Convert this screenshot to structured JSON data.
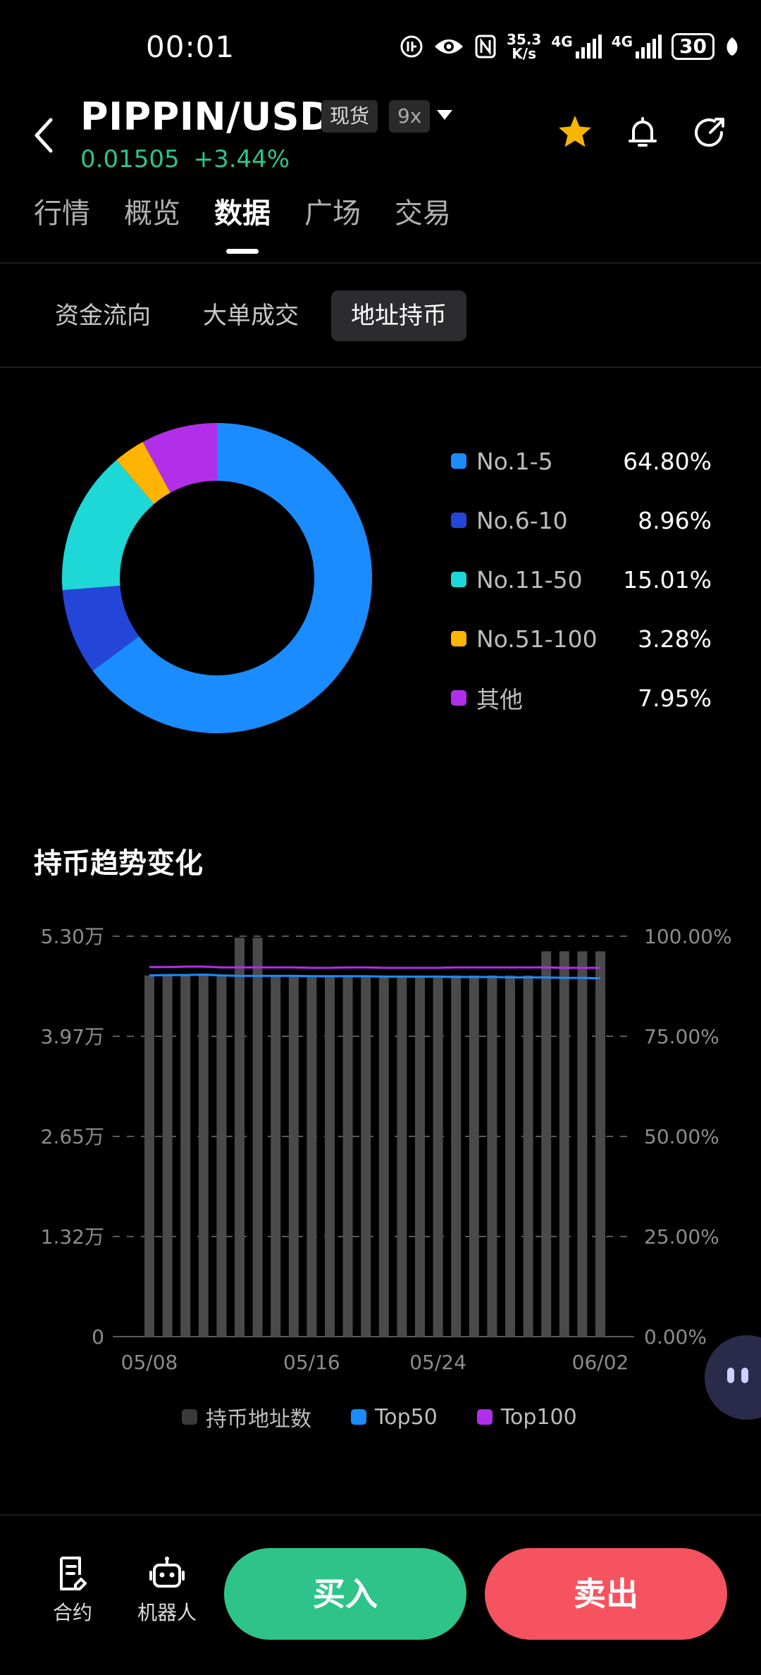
{
  "status_bar": {
    "time": "00:01",
    "net_speed": "35.3",
    "net_unit": "K/s",
    "net1": "4G",
    "net2": "4G",
    "battery": "30"
  },
  "header": {
    "pair": "PIPPIN/USDT",
    "market_tag": "现货",
    "leverage_tag": "9x",
    "price": "0.01505",
    "change": "+3.44%",
    "price_color": "#2ec489"
  },
  "tabs": [
    {
      "label": "行情",
      "active": false
    },
    {
      "label": "概览",
      "active": false
    },
    {
      "label": "数据",
      "active": true
    },
    {
      "label": "广场",
      "active": false
    },
    {
      "label": "交易",
      "active": false
    }
  ],
  "subtabs": [
    {
      "label": "资金流向",
      "active": false
    },
    {
      "label": "大单成交",
      "active": false
    },
    {
      "label": "地址持币",
      "active": true
    }
  ],
  "holdings": {
    "items": [
      {
        "label": "No.1-5",
        "value": "64.80%",
        "pct": 64.8,
        "color": "#1a8cff"
      },
      {
        "label": "No.6-10",
        "value": "8.96%",
        "pct": 8.96,
        "color": "#2446d8"
      },
      {
        "label": "No.11-50",
        "value": "15.01%",
        "pct": 15.01,
        "color": "#1ed8d8"
      },
      {
        "label": "No.51-100",
        "value": "3.28%",
        "pct": 3.28,
        "color": "#ffb400"
      },
      {
        "label": "其他",
        "value": "7.95%",
        "pct": 7.95,
        "color": "#b12fe8"
      }
    ]
  },
  "trend": {
    "title": "持币趋势变化",
    "left_ticks": [
      "0",
      "1.32万",
      "2.65万",
      "3.97万",
      "5.30万"
    ],
    "right_ticks": [
      "0.00%",
      "25.00%",
      "50.00%",
      "75.00%",
      "100.00%"
    ],
    "x_labels": [
      "05/08",
      "05/16",
      "05/24",
      "06/02"
    ],
    "legend": [
      {
        "label": "持币地址数",
        "color": "#3a3a3a"
      },
      {
        "label": "Top50",
        "color": "#1a8cff"
      },
      {
        "label": "Top100",
        "color": "#b12fe8"
      }
    ]
  },
  "chart_data": {
    "type": "bar",
    "title": "持币趋势变化",
    "ylim": [
      0,
      53000
    ],
    "y2lim": [
      0,
      100
    ],
    "x_tick_labels": [
      "05/08",
      "05/16",
      "05/24",
      "06/02"
    ],
    "series": [
      {
        "name": "持币地址数",
        "type": "bar",
        "values": [
          47800,
          47800,
          47800,
          47800,
          47800,
          52800,
          52800,
          47800,
          47800,
          47800,
          47800,
          47800,
          47800,
          47800,
          47800,
          47800,
          47800,
          47800,
          47800,
          47800,
          47800,
          47800,
          51000,
          51000,
          51000,
          51000
        ]
      },
      {
        "name": "Top50",
        "type": "line",
        "axis": "right",
        "values": [
          90.2,
          90.3,
          90.3,
          90.4,
          90.2,
          90.1,
          90.1,
          90.1,
          90.1,
          90.0,
          90.0,
          90.0,
          90.0,
          89.9,
          89.9,
          89.9,
          89.9,
          89.8,
          89.8,
          89.8,
          89.7,
          89.7,
          89.7,
          89.6,
          89.6,
          89.5
        ]
      },
      {
        "name": "Top100",
        "type": "line",
        "axis": "right",
        "values": [
          92.3,
          92.3,
          92.4,
          92.4,
          92.2,
          92.2,
          92.2,
          92.2,
          92.2,
          92.1,
          92.1,
          92.2,
          92.2,
          92.1,
          92.1,
          92.1,
          92.1,
          92.2,
          92.2,
          92.2,
          92.2,
          92.2,
          92.2,
          92.1,
          92.1,
          92.1
        ]
      }
    ]
  },
  "bottom_bar": {
    "contract_label": "合约",
    "bot_label": "机器人",
    "buy_label": "买入",
    "sell_label": "卖出"
  }
}
